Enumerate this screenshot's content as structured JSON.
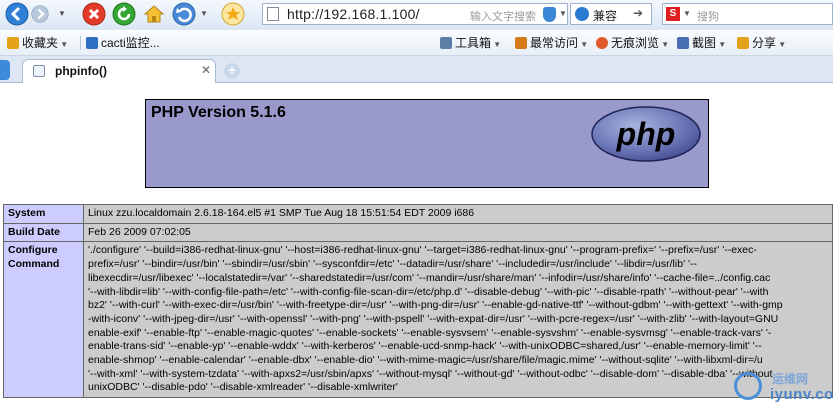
{
  "browser": {
    "address": {
      "url": "http://192.168.1.100/",
      "placeholder": "输入文字搜索"
    },
    "compat_label": "兼容",
    "search_placeholder": "搜狗",
    "favorites": [
      {
        "label": "收藏夹",
        "color": "#e3a21a"
      },
      {
        "label": "cacti监控...",
        "color": "#2f6fc2"
      }
    ],
    "tools": [
      {
        "label": "工具箱",
        "color": "#5c7fa8"
      },
      {
        "label": "最常访问",
        "color": "#d77a1a"
      },
      {
        "label": "无痕浏览",
        "color": "#e05a2a"
      },
      {
        "label": "截图",
        "color": "#4a6fb0"
      },
      {
        "label": "分享",
        "color": "#e3a21a"
      }
    ],
    "tab": {
      "title": "phpinfo()"
    }
  },
  "phpinfo": {
    "version_title": "PHP Version 5.1.6",
    "logo_text": "php",
    "rows": [
      {
        "key": "System",
        "value": "Linux zzu.localdomain 2.6.18-164.el5 #1 SMP Tue Aug 18 15:51:54 EDT 2009 i686"
      },
      {
        "key": "Build Date",
        "value": "Feb 26 2009 07:02:05"
      },
      {
        "key": "Configure Command",
        "lines": [
          "'./configure' '--build=i386-redhat-linux-gnu' '--host=i386-redhat-linux-gnu' '--target=i386-redhat-linux-gnu' '--program-prefix=' '--prefix=/usr' '--exec-",
          "prefix=/usr' '--bindir=/usr/bin' '--sbindir=/usr/sbin' '--sysconfdir=/etc' '--datadir=/usr/share' '--includedir=/usr/include' '--libdir=/usr/lib' '--",
          "libexecdir=/usr/libexec' '--localstatedir=/var' '--sharedstatedir=/usr/com' '--mandir=/usr/share/man' '--infodir=/usr/share/info' '--cache-file=../config.cac",
          "'--with-libdir=lib' '--with-config-file-path=/etc' '--with-config-file-scan-dir=/etc/php.d' '--disable-debug' '--with-pic' '--disable-rpath' '--without-pear' '--with",
          "bz2' '--with-curl' '--with-exec-dir=/usr/bin' '--with-freetype-dir=/usr' '--with-png-dir=/usr' '--enable-gd-native-ttf' '--without-gdbm' '--with-gettext' '--with-gmp",
          "-with-iconv' '--with-jpeg-dir=/usr' '--with-openssl' '--with-png' '--with-pspell' '--with-expat-dir=/usr' '--with-pcre-regex=/usr' '--with-zlib' '--with-layout=GNU",
          "enable-exif' '--enable-ftp' '--enable-magic-quotes' '--enable-sockets' '--enable-sysvsem' '--enable-sysvshm' '--enable-sysvmsg' '--enable-track-vars' '-",
          "enable-trans-sid' '--enable-yp' '--enable-wddx' '--with-kerberos' '--enable-ucd-snmp-hack' '--with-unixODBC=shared,/usr' '--enable-memory-limit' '--",
          "enable-shmop' '--enable-calendar' '--enable-dbx' '--enable-dio' '--with-mime-magic=/usr/share/file/magic.mime' '--without-sqlite' '--with-libxml-dir=/u",
          "'--with-xml' '--with-system-tzdata' '--with-apxs2=/usr/sbin/apxs' '--without-mysql' '--without-gd' '--without-odbc' '--disable-dom' '--disable-dba' '--without",
          "unixODBC' '--disable-pdo' '--disable-xmlreader' '--disable-xmlwriter'"
        ]
      }
    ]
  },
  "watermark": {
    "line1": "运维网",
    "line2": "iyunv.com"
  }
}
